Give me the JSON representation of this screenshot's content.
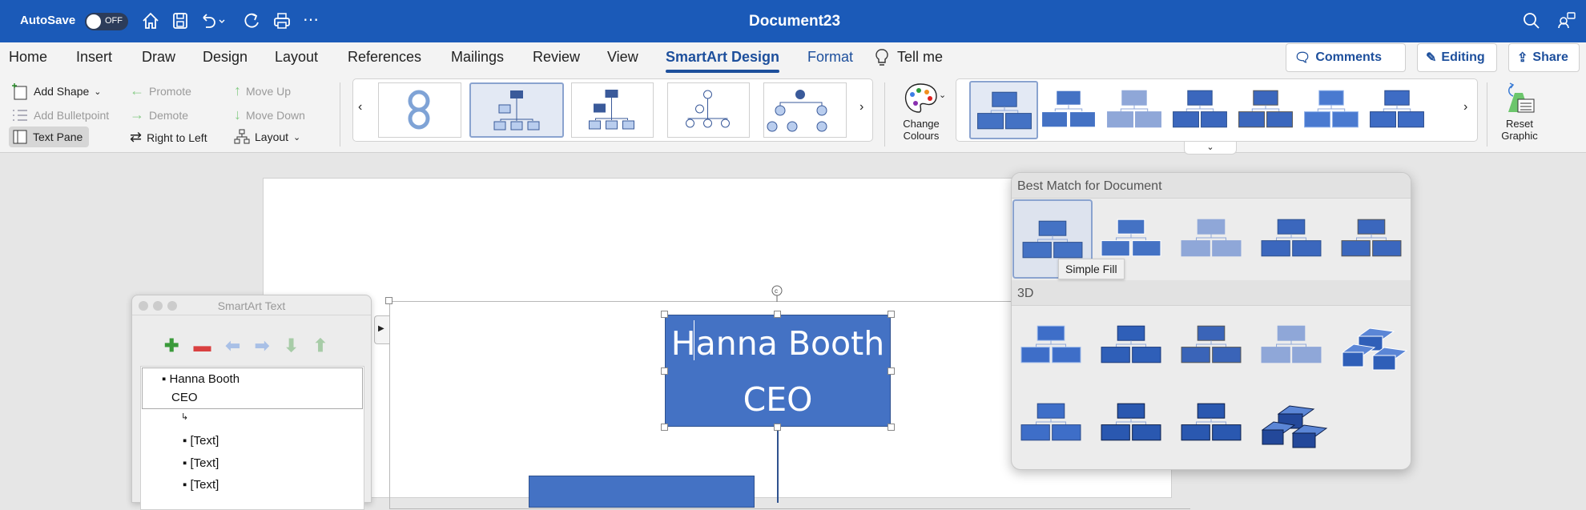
{
  "titlebar": {
    "autosave_label": "AutoSave",
    "autosave_state": "OFF",
    "document_title": "Document23",
    "icons": [
      "home-icon",
      "save-icon",
      "undo-icon",
      "redo-icon",
      "print-icon",
      "more-icon",
      "search-icon",
      "share-people-icon"
    ]
  },
  "tabs": [
    {
      "label": "Home"
    },
    {
      "label": "Insert"
    },
    {
      "label": "Draw"
    },
    {
      "label": "Design"
    },
    {
      "label": "Layout"
    },
    {
      "label": "References"
    },
    {
      "label": "Mailings"
    },
    {
      "label": "Review"
    },
    {
      "label": "View"
    },
    {
      "label": "SmartArt Design",
      "active": true
    },
    {
      "label": "Format"
    }
  ],
  "tell_me": "Tell me",
  "actions": {
    "comments": "Comments",
    "editing": "Editing",
    "share": "Share"
  },
  "ribbon": {
    "add_shape": "Add Shape",
    "add_bulletpoint": "Add Bulletpoint",
    "text_pane": "Text Pane",
    "promote": "Promote",
    "demote": "Demote",
    "right_to_left": "Right to Left",
    "move_up": "Move Up",
    "move_down": "Move Down",
    "layout": "Layout",
    "change_colours_1": "Change",
    "change_colours_2": "Colours",
    "reset_1": "Reset",
    "reset_2": "Graphic"
  },
  "colors": {
    "accent": "#1b5ab8",
    "shape": "#4472c4",
    "shape_light": "#8fa7d8"
  },
  "pane": {
    "title": "SmartArt Text",
    "items": [
      {
        "text": "Hanna Booth",
        "level": 0
      },
      {
        "text": "CEO",
        "level": 0,
        "continuation": true
      },
      {
        "text": "↳",
        "level": 1
      },
      {
        "text": "[Text]",
        "level": 1
      },
      {
        "text": "[Text]",
        "level": 1
      },
      {
        "text": "[Text]",
        "level": 1
      }
    ]
  },
  "diagram": {
    "top_name": "Hanna Booth",
    "top_title": "CEO"
  },
  "dropdown": {
    "section1": "Best Match for Document",
    "section2": "3D",
    "tooltip": "Simple Fill"
  }
}
